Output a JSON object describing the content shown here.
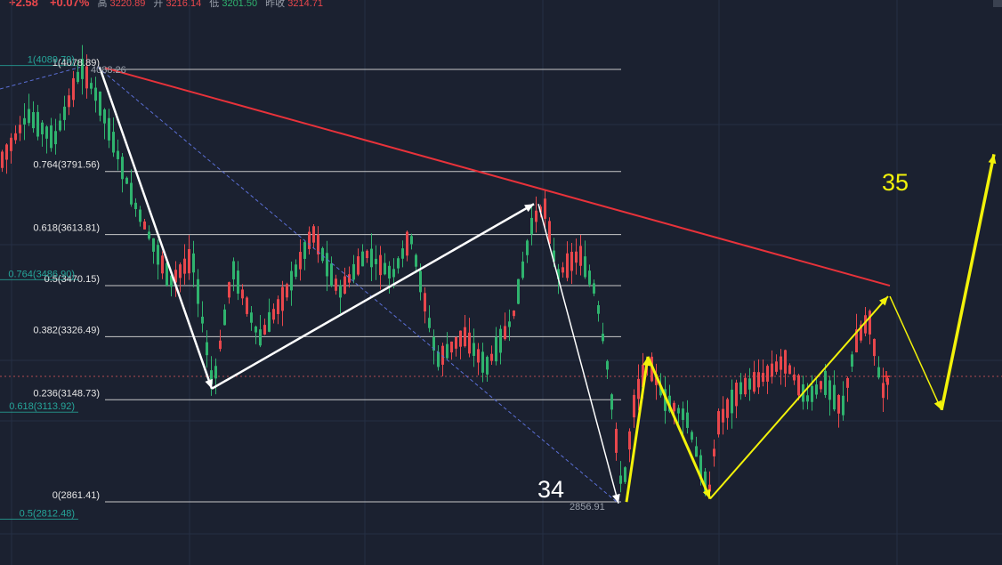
{
  "header": {
    "change": "+2.58",
    "change_pct": "+0.07%",
    "high_label": "高",
    "high": "3220.89",
    "open_label": "开",
    "open": "3216.14",
    "low_label": "低",
    "low": "3201.50",
    "prev_label": "昨收",
    "prev": "3214.71"
  },
  "chart_data": {
    "type": "candlestick",
    "y_range": [
      2730,
      4180
    ],
    "fib_levels": [
      {
        "label": "1(4078.89)",
        "price": 4078.89
      },
      {
        "label": "0.764(3791.56)",
        "price": 3791.56
      },
      {
        "label": "0.618(3613.81)",
        "price": 3613.81
      },
      {
        "label": "0.5(3470.15)",
        "price": 3470.15
      },
      {
        "label": "0.382(3326.49)",
        "price": 3326.49
      },
      {
        "label": "0.236(3148.73)",
        "price": 3148.73
      },
      {
        "label": "0(2861.41)",
        "price": 2861.41
      }
    ],
    "left_fib_levels": [
      {
        "label": "1(4089.79)",
        "price": 4089.79
      },
      {
        "label": "0.764(3486.90)",
        "price": 3486.9
      },
      {
        "label": "0.618(3113.92)",
        "price": 3113.92
      },
      {
        "label": "0.5(2812.48)",
        "price": 2812.48
      }
    ],
    "extreme_labels": [
      {
        "label": "4088.26",
        "price": 4088.26
      },
      {
        "label": "2856.91",
        "price": 2856.91
      }
    ],
    "current_price": 3214.71,
    "wave_numbers": [
      "34",
      "35"
    ],
    "key_points": {
      "high": 4088.26,
      "low_1": 3180,
      "swing_high": 3700,
      "low_2": 2856.91,
      "rebound": 3270,
      "dip": 2870,
      "target_1": 3440,
      "pullback": 3120,
      "target_2": 3840
    },
    "trendline_red": [
      4083,
      3470
    ],
    "colors": {
      "background": "#1b2130",
      "grid": "#263044",
      "fib_line": "#c8c8c8",
      "left_fib_label": "#26a69a",
      "up_candle": "#e8474c",
      "down_candle": "#2fb36e",
      "trendline": "#e8323a",
      "wave_white": "#ffffff",
      "wave_yellow": "#f2f20a"
    }
  }
}
